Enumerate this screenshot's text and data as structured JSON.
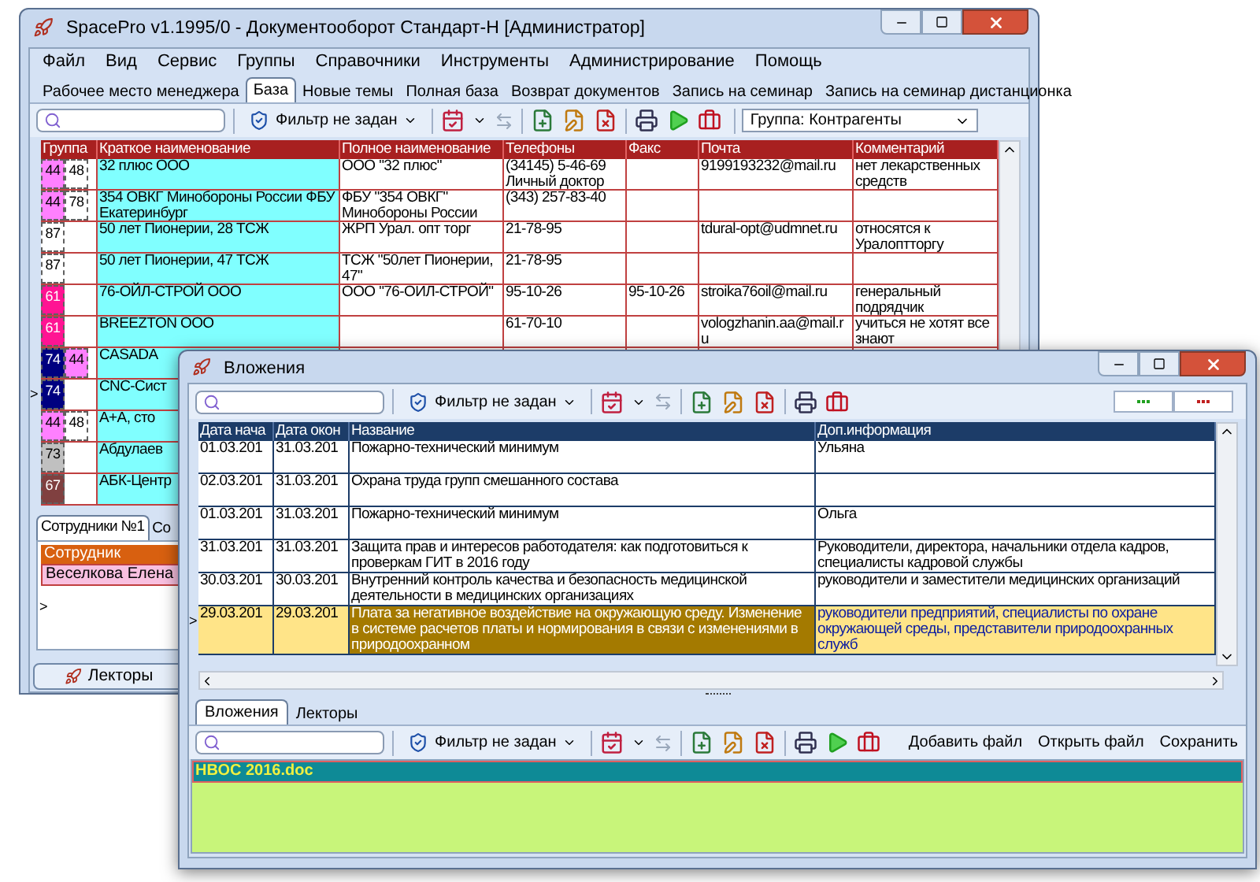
{
  "main_window": {
    "title": "SpacePro v1.1995/0 - Документооборот Стандарт-Н [Администратор]",
    "menu": [
      "Файл",
      "Вид",
      "Сервис",
      "Группы",
      "Справочники",
      "Инструменты",
      "Администрирование",
      "Помощь"
    ],
    "tabs": [
      {
        "label": "Рабочее место менеджера",
        "selected": false
      },
      {
        "label": "База",
        "selected": true
      },
      {
        "label": "Новые темы",
        "selected": false
      },
      {
        "label": "Полная база",
        "selected": false
      },
      {
        "label": "Возврат документов",
        "selected": false
      },
      {
        "label": "Запись на семинар",
        "selected": false
      },
      {
        "label": "Запись на семинар дистанционка",
        "selected": false
      }
    ],
    "filter": "Фильтр не задан",
    "group_select": "Группа: Контрагенты",
    "table": {
      "columns": [
        "Группа",
        "Краткое наименование",
        "Полное наименование",
        "Телефоны",
        "Факс",
        "Почта",
        "Комментарий"
      ],
      "current_marker": ">",
      "rows": [
        {
          "groups": [
            {
              "code": "44",
              "color": "#ff80ff"
            },
            {
              "code": "48",
              "color": "#ffffff"
            }
          ],
          "short": "32 плюс ООО",
          "full": "ООО \"32 плюс\"",
          "phones": "(34145) 5-46-69 Личный доктор",
          "mail": "9199193232@mail.ru",
          "comment": "нет лекарственных средств",
          "current": false
        },
        {
          "groups": [
            {
              "code": "44",
              "color": "#ff80ff"
            },
            {
              "code": "78",
              "color": "#ffffff"
            }
          ],
          "short": "354 ОВКГ Минобороны России ФБУ Екатеринбург",
          "full": "ФБУ \"354 ОВКГ\" Минобороны России",
          "phones": "(343) 257-83-40",
          "current": false
        },
        {
          "groups": [
            {
              "code": "87",
              "color": "#ffffff"
            }
          ],
          "short": "50 лет Пионерии, 28 ТСЖ",
          "full": "ЖРП Урал. опт торг",
          "phones": "21-78-95",
          "mail": "tdural-opt@udmnet.ru",
          "comment": "относятся к Уралоптторгу",
          "current": false
        },
        {
          "groups": [
            {
              "code": "87",
              "color": "#ffffff"
            }
          ],
          "short": "50 лет Пионерии, 47 ТСЖ",
          "full": "ТСЖ \"50лет Пионерии, 47\"",
          "phones": "21-78-95",
          "current": false
        },
        {
          "groups": [
            {
              "code": "61",
              "color": "#ff1493"
            }
          ],
          "short": "76-ОЙЛ-СТРОЙ ООО",
          "full": "ООО \"76-ОИЛ-СТРОЙ\"",
          "phones": "95-10-26",
          "fax": "95-10-26",
          "mail": "stroika76oil@mail.ru",
          "comment": "генеральный подрядчик",
          "current": false
        },
        {
          "groups": [
            {
              "code": "61",
              "color": "#ff1493"
            }
          ],
          "short": "BREEZTON ООО",
          "phones": "61-70-10",
          "mail": "vologzhanin.aa@mail.ru",
          "comment": "учиться не хотят все знают",
          "current": false
        },
        {
          "groups": [
            {
              "code": "74",
              "color": "#000080"
            },
            {
              "code": "44",
              "color": "#ff80ff"
            }
          ],
          "short": "CASADA",
          "current": false
        },
        {
          "groups": [
            {
              "code": "74",
              "color": "#000080"
            }
          ],
          "short": "CNC-Сист",
          "current": true
        },
        {
          "groups": [
            {
              "code": "44",
              "color": "#ff80ff"
            },
            {
              "code": "48",
              "color": "#ffffff"
            }
          ],
          "short": "А+А, сто",
          "current": false
        },
        {
          "groups": [
            {
              "code": "73",
              "color": "#c0c0c0"
            }
          ],
          "short": "Абдулаев",
          "current": false
        },
        {
          "groups": [
            {
              "code": "67",
              "color": "#804040"
            }
          ],
          "short": "АБК-Центр",
          "current": false
        }
      ]
    },
    "staff_tabs": [
      {
        "label": "Сотрудники №1",
        "selected": true
      },
      {
        "label": "Со",
        "selected": false
      }
    ],
    "staff_table": {
      "column": "Сотрудник",
      "rows": [
        "Веселкова Елена"
      ],
      "new_row_marker": ">"
    },
    "lectors_button": "Лекторы"
  },
  "dialog": {
    "title": "Вложения",
    "filter": "Фильтр не задан",
    "table": {
      "columns": [
        "Дата нача",
        "Дата окон",
        "Название",
        "Доп.информация"
      ],
      "current_marker": ">",
      "rows": [
        {
          "start": "01.03.201",
          "end": "31.03.201",
          "name": "Пожарно-технический минимум",
          "info": "Ульяна",
          "selected": false
        },
        {
          "start": "02.03.201",
          "end": "31.03.201",
          "name": "Охрана труда групп смешанного состава",
          "selected": false
        },
        {
          "start": "01.03.201",
          "end": "31.03.201",
          "name": "Пожарно-технический минимум",
          "info": "Ольга",
          "selected": false
        },
        {
          "start": "31.03.201",
          "end": "31.03.201",
          "name": "Защита прав и интересов работодателя: как подготовиться к проверкам ГИТ в 2016 году",
          "info": "Руководители, директора, начальники отдела кадров, специалисты кадровой службы",
          "selected": false
        },
        {
          "start": "30.03.201",
          "end": "30.03.201",
          "name": "Внутренний контроль качества и безопасность медицинской деятельности в медицинских организациях",
          "info": "руководители и заместители медицинских организаций",
          "selected": false
        },
        {
          "start": "29.03.201",
          "end": "29.03.201",
          "name": "Плата за негативное воздействие на окружающую среду. Изменение в системе расчетов платы и нормирования в связи с изменениями в природоохранном",
          "info": "руководители предприятий, специалисты по охране окружающей среды, представители природоохранных служб",
          "selected": true
        }
      ]
    },
    "tabs": [
      {
        "label": "Вложения",
        "selected": true
      },
      {
        "label": "Лекторы",
        "selected": false
      }
    ],
    "filter_2": "Фильтр не задан",
    "actions": [
      "Добавить файл",
      "Открыть файл",
      "Сохранить"
    ],
    "files": [
      {
        "name": "НВОС 2016.doc",
        "selected": true
      }
    ]
  }
}
